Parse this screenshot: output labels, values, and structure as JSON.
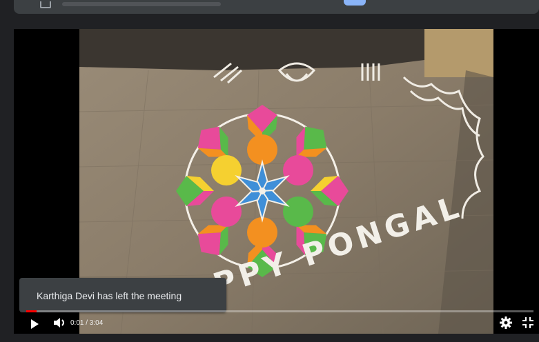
{
  "app": {
    "title": ""
  },
  "toast": {
    "message": "Karthiga Devi has left the meeting"
  },
  "player": {
    "time_display": "0:01 / 3:04",
    "progress": 0.005,
    "icons": {
      "play": "play-icon",
      "volume": "volume-icon",
      "settings": "gear-icon",
      "fullscreen_exit": "exit-fullscreen-icon"
    }
  },
  "video": {
    "drawn_text": "HAPPY PONGAL"
  },
  "colors": {
    "background": "#202124",
    "toast_bg": "#3c4043",
    "progress": "#ff0000",
    "toggle": "#8ab4f8"
  }
}
